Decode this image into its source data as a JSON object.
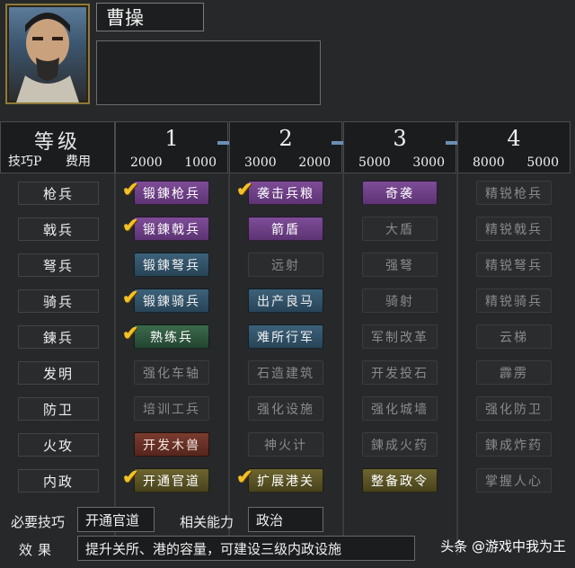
{
  "character": {
    "name": "曹操"
  },
  "header": {
    "level_label": "等级",
    "cost_labels": [
      "技巧P",
      "费用"
    ],
    "levels": [
      {
        "num": "1",
        "tech_p": "2000",
        "cost": "1000"
      },
      {
        "num": "2",
        "tech_p": "3000",
        "cost": "2000"
      },
      {
        "num": "3",
        "tech_p": "5000",
        "cost": "3000"
      },
      {
        "num": "4",
        "tech_p": "8000",
        "cost": "5000"
      }
    ]
  },
  "rows": [
    {
      "label": "枪兵",
      "skills": [
        {
          "name": "锻鍊枪兵",
          "color": "purple",
          "learned": true
        },
        {
          "name": "袭击兵粮",
          "color": "purple",
          "learned": true
        },
        {
          "name": "奇袭",
          "color": "purple",
          "learned": false
        },
        {
          "name": "精锐枪兵",
          "color": "dim",
          "learned": false
        }
      ]
    },
    {
      "label": "戟兵",
      "skills": [
        {
          "name": "锻鍊戟兵",
          "color": "purple",
          "learned": true
        },
        {
          "name": "箭盾",
          "color": "purple",
          "learned": false
        },
        {
          "name": "大盾",
          "color": "dim",
          "learned": false
        },
        {
          "name": "精锐戟兵",
          "color": "dim",
          "learned": false
        }
      ]
    },
    {
      "label": "弩兵",
      "skills": [
        {
          "name": "锻鍊弩兵",
          "color": "blue",
          "learned": false
        },
        {
          "name": "远射",
          "color": "dim",
          "learned": false
        },
        {
          "name": "强弩",
          "color": "dim",
          "learned": false
        },
        {
          "name": "精锐弩兵",
          "color": "dim",
          "learned": false
        }
      ]
    },
    {
      "label": "骑兵",
      "skills": [
        {
          "name": "锻鍊骑兵",
          "color": "blue",
          "learned": true
        },
        {
          "name": "出产良马",
          "color": "blue",
          "learned": false
        },
        {
          "name": "骑射",
          "color": "dim",
          "learned": false
        },
        {
          "name": "精锐骑兵",
          "color": "dim",
          "learned": false
        }
      ]
    },
    {
      "label": "鍊兵",
      "skills": [
        {
          "name": "熟练兵",
          "color": "green",
          "learned": true
        },
        {
          "name": "难所行军",
          "color": "blue",
          "learned": false
        },
        {
          "name": "军制改革",
          "color": "dim",
          "learned": false
        },
        {
          "name": "云梯",
          "color": "dim",
          "learned": false
        }
      ]
    },
    {
      "label": "发明",
      "skills": [
        {
          "name": "强化车轴",
          "color": "dim",
          "learned": false
        },
        {
          "name": "石造建筑",
          "color": "dim",
          "learned": false
        },
        {
          "name": "开发投石",
          "color": "dim",
          "learned": false
        },
        {
          "name": "霹雳",
          "color": "dim",
          "learned": false
        }
      ]
    },
    {
      "label": "防卫",
      "skills": [
        {
          "name": "培训工兵",
          "color": "dim",
          "learned": false
        },
        {
          "name": "强化设施",
          "color": "dim",
          "learned": false
        },
        {
          "name": "强化城墙",
          "color": "dim",
          "learned": false
        },
        {
          "name": "强化防卫",
          "color": "dim",
          "learned": false
        }
      ]
    },
    {
      "label": "火攻",
      "skills": [
        {
          "name": "开发木兽",
          "color": "red",
          "learned": false
        },
        {
          "name": "神火计",
          "color": "dim",
          "learned": false
        },
        {
          "name": "鍊成火药",
          "color": "dim",
          "learned": false
        },
        {
          "name": "鍊成炸药",
          "color": "dim",
          "learned": false
        }
      ]
    },
    {
      "label": "内政",
      "skills": [
        {
          "name": "开通官道",
          "color": "olive",
          "learned": true
        },
        {
          "name": "扩展港关",
          "color": "olive",
          "learned": true
        },
        {
          "name": "整备政令",
          "color": "olive",
          "learned": false
        },
        {
          "name": "掌握人心",
          "color": "dim",
          "learned": false
        }
      ]
    }
  ],
  "footer": {
    "required_label": "必要技巧",
    "required_value": "开通官道",
    "ability_label": "相关能力",
    "ability_value": "政治",
    "effect_label": "效果",
    "effect_value": "提升关所、港的容量，可建设三级内政设施"
  },
  "watermark": "头条 @游戏中我为王",
  "colors": {
    "checkmark": "#f2c028",
    "purple": "#6d4185",
    "blue": "#30536a",
    "green": "#2f5a3e",
    "red": "#6a3025",
    "olive": "#5b5426"
  }
}
